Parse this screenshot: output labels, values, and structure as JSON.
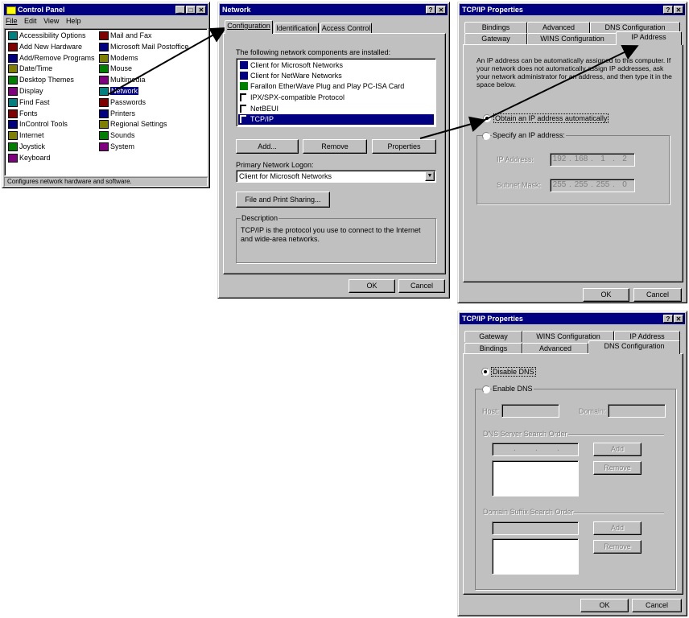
{
  "control_panel": {
    "title": "Control Panel",
    "menu": [
      "File",
      "Edit",
      "View",
      "Help"
    ],
    "col1": [
      "Accessibility Options",
      "Add New Hardware",
      "Add/Remove Programs",
      "Date/Time",
      "Desktop Themes",
      "Display",
      "Find Fast",
      "Fonts",
      "InControl Tools",
      "Internet",
      "Joystick",
      "Keyboard"
    ],
    "col2": [
      "Mail and Fax",
      "Microsoft Mail Postoffice",
      "Modems",
      "Mouse",
      "Multimedia",
      "Network",
      "Passwords",
      "Printers",
      "Regional Settings",
      "Sounds",
      "System"
    ],
    "selected": "Network",
    "status": "Configures network hardware and software."
  },
  "network": {
    "title": "Network",
    "tabs": [
      "Configuration",
      "Identification",
      "Access Control"
    ],
    "installed_label": "The following network components are installed:",
    "components": [
      "Client for Microsoft Networks",
      "Client for NetWare Networks",
      "Farallon EtherWave Plug and Play PC-ISA Card",
      "IPX/SPX-compatible Protocol",
      "NetBEUI",
      "TCP/IP"
    ],
    "selected_component": "TCP/IP",
    "add": "Add...",
    "remove": "Remove",
    "properties": "Properties",
    "logon_label": "Primary Network Logon:",
    "logon_value": "Client for Microsoft Networks",
    "file_print": "File and Print Sharing...",
    "description_label": "Description",
    "description_text": "TCP/IP is the protocol you use to connect to the Internet and wide-area networks.",
    "ok": "OK",
    "cancel": "Cancel"
  },
  "tcpip_ip": {
    "title": "TCP/IP Properties",
    "tabs_back": [
      "Bindings",
      "Advanced",
      "DNS Configuration"
    ],
    "tabs_front": [
      "Gateway",
      "WINS Configuration",
      "IP Address"
    ],
    "info": "An IP address can be automatically assigned to this computer. If your network does not automatically assign IP addresses, ask your network administrator for an address, and then type it in the space below.",
    "obtain": "Obtain an IP address automatically",
    "specify": "Specify an IP address:",
    "ip_label": "IP Address:",
    "mask_label": "Subnet Mask:",
    "ip": [
      "192",
      "168",
      "1",
      "2"
    ],
    "mask": [
      "255",
      "255",
      "255",
      "0"
    ],
    "ok": "OK",
    "cancel": "Cancel"
  },
  "tcpip_dns": {
    "title": "TCP/IP Properties",
    "tabs_back": [
      "Gateway",
      "WINS Configuration",
      "IP Address"
    ],
    "tabs_front": [
      "Bindings",
      "Advanced",
      "DNS Configuration"
    ],
    "disable": "Disable DNS",
    "enable": "Enable DNS",
    "host_label": "Host:",
    "domain_label": "Domain:",
    "search_order_label": "DNS Server Search Order",
    "suffix_label": "Domain Suffix Search Order",
    "add": "Add",
    "remove": "Remove",
    "ok": "OK",
    "cancel": "Cancel"
  },
  "colors": {
    "titlebar": "#000080",
    "face": "#c0c0c0",
    "arrow": "#000000"
  }
}
